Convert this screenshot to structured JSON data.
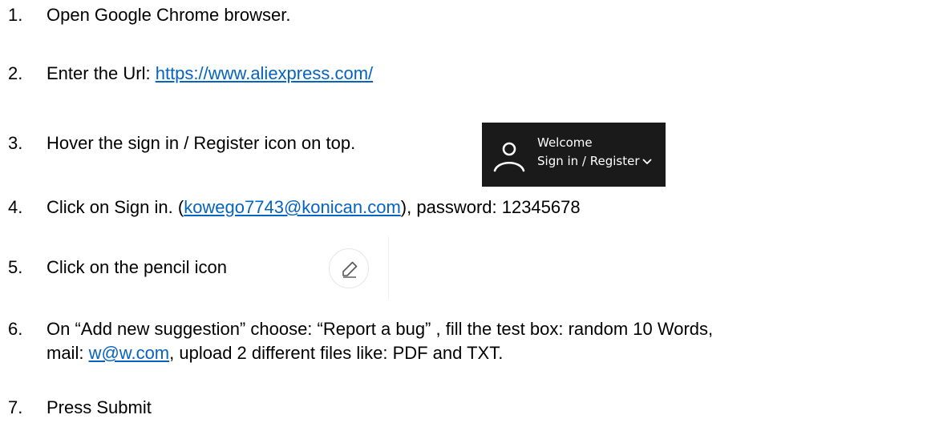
{
  "steps": [
    {
      "num": "1.",
      "text": "Open Google Chrome browser."
    },
    {
      "num": "2.",
      "text_before": "Enter the Url: ",
      "link": "https://www.aliexpress.com/"
    },
    {
      "num": "3.",
      "text": "Hover the sign in / Register icon on top."
    },
    {
      "num": "4.",
      "text_before": "Click on Sign in. (",
      "link": "kowego7743@konican.com",
      "text_after": "), password: 12345678"
    },
    {
      "num": "5.",
      "text": "Click on the pencil icon"
    },
    {
      "num": "6.",
      "line1": "On “Add new suggestion” choose: “Report a bug” , fill the test box: random 10 Words,",
      "line2_before": "mail: ",
      "line2_link": "w@w.com",
      "line2_after": ", upload 2 different files like: PDF and TXT."
    },
    {
      "num": "7.",
      "text": "Press Submit"
    }
  ],
  "welcome_widget": {
    "title": "Welcome",
    "action": "Sign in / Register",
    "icon": "user-icon",
    "chevron_icon": "chevron-down-icon",
    "background": "#1a1a1a"
  },
  "pencil": {
    "icon": "pencil-icon"
  },
  "colors": {
    "link": "#0563c1",
    "text": "#000000"
  }
}
